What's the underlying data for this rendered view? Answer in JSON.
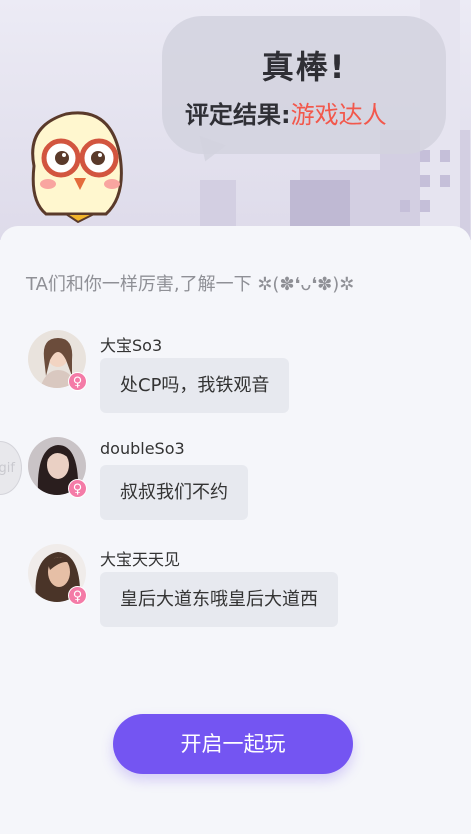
{
  "result": {
    "title": "真棒!",
    "label": "评定结果:",
    "value": "游戏达人"
  },
  "intro_text": "TA们和你一样厉害,了解一下 ✲(✽❛ᴗ❛✽)✲",
  "gif_badge": "gif",
  "users": [
    {
      "name": "大宝So3",
      "message": "处CP吗，我铁观音",
      "gender_symbol": "♀"
    },
    {
      "name": "doubleSo3",
      "message": "叔叔我们不约",
      "gender_symbol": "♀"
    },
    {
      "name": "大宝天天见",
      "message": "皇后大道东哦皇后大道西",
      "gender_symbol": "♀"
    }
  ],
  "cta_label": "开启一起玩",
  "colors": {
    "accent": "#7455f2",
    "result_value": "#f2584c",
    "female_badge": "#f47ba7"
  }
}
